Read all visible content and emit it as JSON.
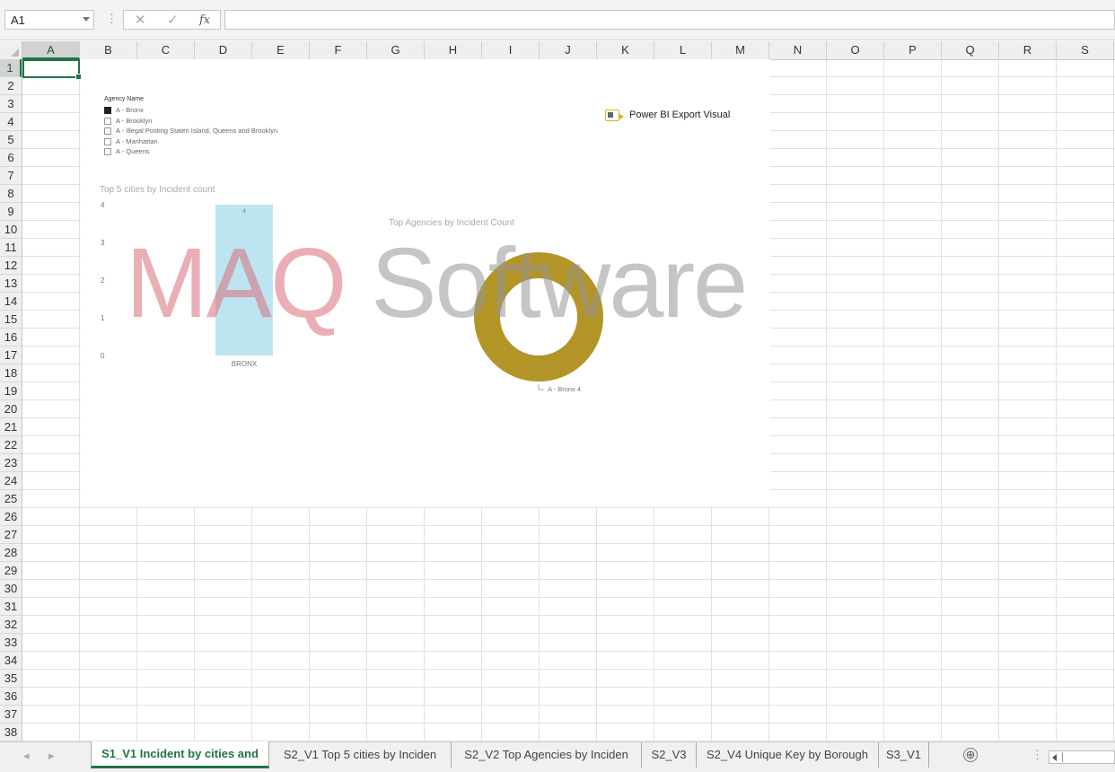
{
  "formula_bar": {
    "name_box": "A1",
    "cancel_icon": "✕",
    "enter_icon": "✓",
    "fx_label": "fx",
    "formula": ""
  },
  "columns": [
    "A",
    "B",
    "C",
    "D",
    "E",
    "F",
    "G",
    "H",
    "I",
    "J",
    "K",
    "L",
    "M",
    "N",
    "O",
    "P",
    "Q",
    "R",
    "S"
  ],
  "rows": [
    "1",
    "2",
    "3",
    "4",
    "5",
    "6",
    "7",
    "8",
    "9",
    "10",
    "11",
    "12",
    "13",
    "14",
    "15",
    "16",
    "17",
    "18",
    "19",
    "20",
    "21",
    "22",
    "23",
    "24",
    "25",
    "26",
    "27",
    "28",
    "29",
    "30",
    "31",
    "32",
    "33",
    "34",
    "35",
    "36",
    "37",
    "38"
  ],
  "selected": {
    "column": "A",
    "row": "1"
  },
  "visual": {
    "legend": {
      "title": "Agency Name",
      "items": [
        {
          "label": "A - Bronx",
          "checked": true
        },
        {
          "label": "A - Brooklyn",
          "checked": false
        },
        {
          "label": "A - Illegal Posting Staten Island, Queens and Brooklyn",
          "checked": false
        },
        {
          "label": "A - Manhattan",
          "checked": false
        },
        {
          "label": "A - Queens",
          "checked": false
        }
      ]
    },
    "export_button": "Power BI Export Visual",
    "watermark": {
      "part1": "MAQ",
      "part2": " Software"
    }
  },
  "chart_data": [
    {
      "type": "bar",
      "title": "Top 5 cities by Incident count",
      "categories": [
        "BRONX"
      ],
      "values": [
        4
      ],
      "yticks": [
        "0",
        "1",
        "2",
        "3",
        "4"
      ],
      "ylim": [
        0,
        4
      ],
      "data_labels": [
        "4"
      ],
      "color": "#bde4f1"
    },
    {
      "type": "pie",
      "title": "Top Agencies by Incident Count",
      "categories": [
        "A - Bronx"
      ],
      "values": [
        4
      ],
      "data_labels": [
        "A - Bronx 4"
      ],
      "donut": true,
      "color": "#b39527"
    }
  ],
  "sheet_tabs": {
    "items": [
      {
        "label": "S1_V1 Incident by cities and",
        "active": true
      },
      {
        "label": "S2_V1 Top 5 cities by Inciden",
        "active": false
      },
      {
        "label": "S2_V2 Top Agencies by Inciden",
        "active": false
      },
      {
        "label": "S2_V3",
        "active": false
      },
      {
        "label": "S2_V4 Unique Key by Borough",
        "active": false
      },
      {
        "label": "S3_V1",
        "active": false
      }
    ],
    "add_icon": "⊕",
    "options_icon": "⋮"
  }
}
